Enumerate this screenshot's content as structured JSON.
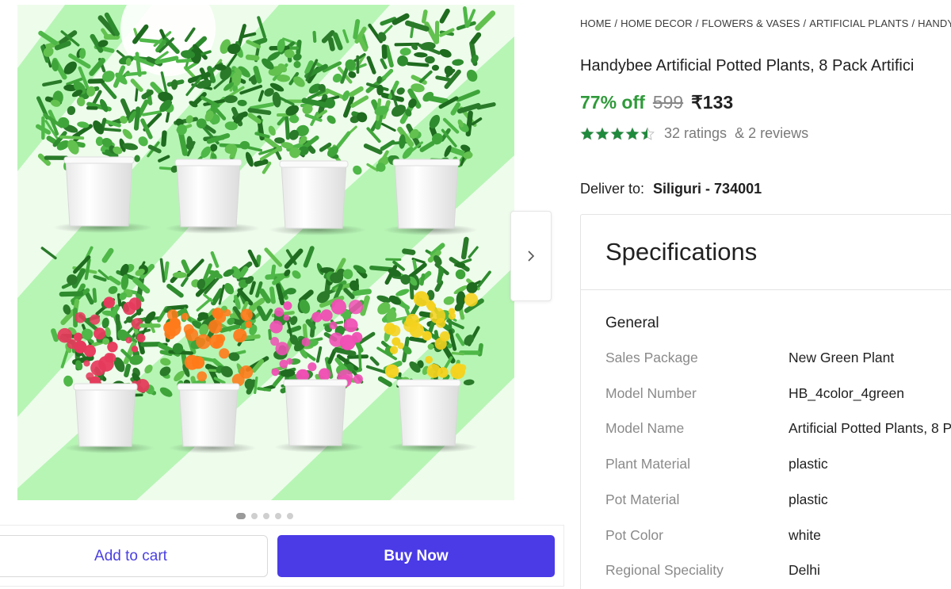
{
  "breadcrumb": [
    "HOME",
    "HOME DECOR",
    "FLOWERS & VASES",
    "ARTIFICIAL PLANTS",
    "HANDYB"
  ],
  "product": {
    "title": "Handybee Artificial Potted Plants, 8 Pack Artifici",
    "discount": "77% off",
    "mrp": "599",
    "price": "₹133",
    "rating_value": 4.5,
    "ratings_text": "32 ratings",
    "reviews_text": "& 2 reviews"
  },
  "delivery": {
    "label": "Deliver to:",
    "location": "Siliguri - 734001"
  },
  "carousel": {
    "dot_count": 5,
    "active_index": 0,
    "next_icon": "chevron-right-icon"
  },
  "actions": {
    "add_to_cart": "Add to cart",
    "buy_now": "Buy Now"
  },
  "specifications": {
    "title": "Specifications",
    "group": "General",
    "rows": [
      {
        "key": "Sales Package",
        "value": "New Green Plant"
      },
      {
        "key": "Model Number",
        "value": "HB_4color_4green"
      },
      {
        "key": "Model Name",
        "value": "Artificial Potted Plants, 8 P"
      },
      {
        "key": "Plant Material",
        "value": "plastic"
      },
      {
        "key": "Pot Material",
        "value": "plastic"
      },
      {
        "key": "Pot Color",
        "value": "white"
      },
      {
        "key": "Regional Speciality",
        "value": "Delhi"
      }
    ]
  },
  "colors": {
    "accent": "#4a3be6",
    "discount_green": "#2f9a3a",
    "star_green": "#1f8a3c",
    "image_bg_light": "#e9fbe6",
    "image_stripe": "#b7f5b5",
    "flower_colors": [
      "#e63a5c",
      "#ff7a1a",
      "#f04fb4",
      "#f5d21e"
    ]
  }
}
